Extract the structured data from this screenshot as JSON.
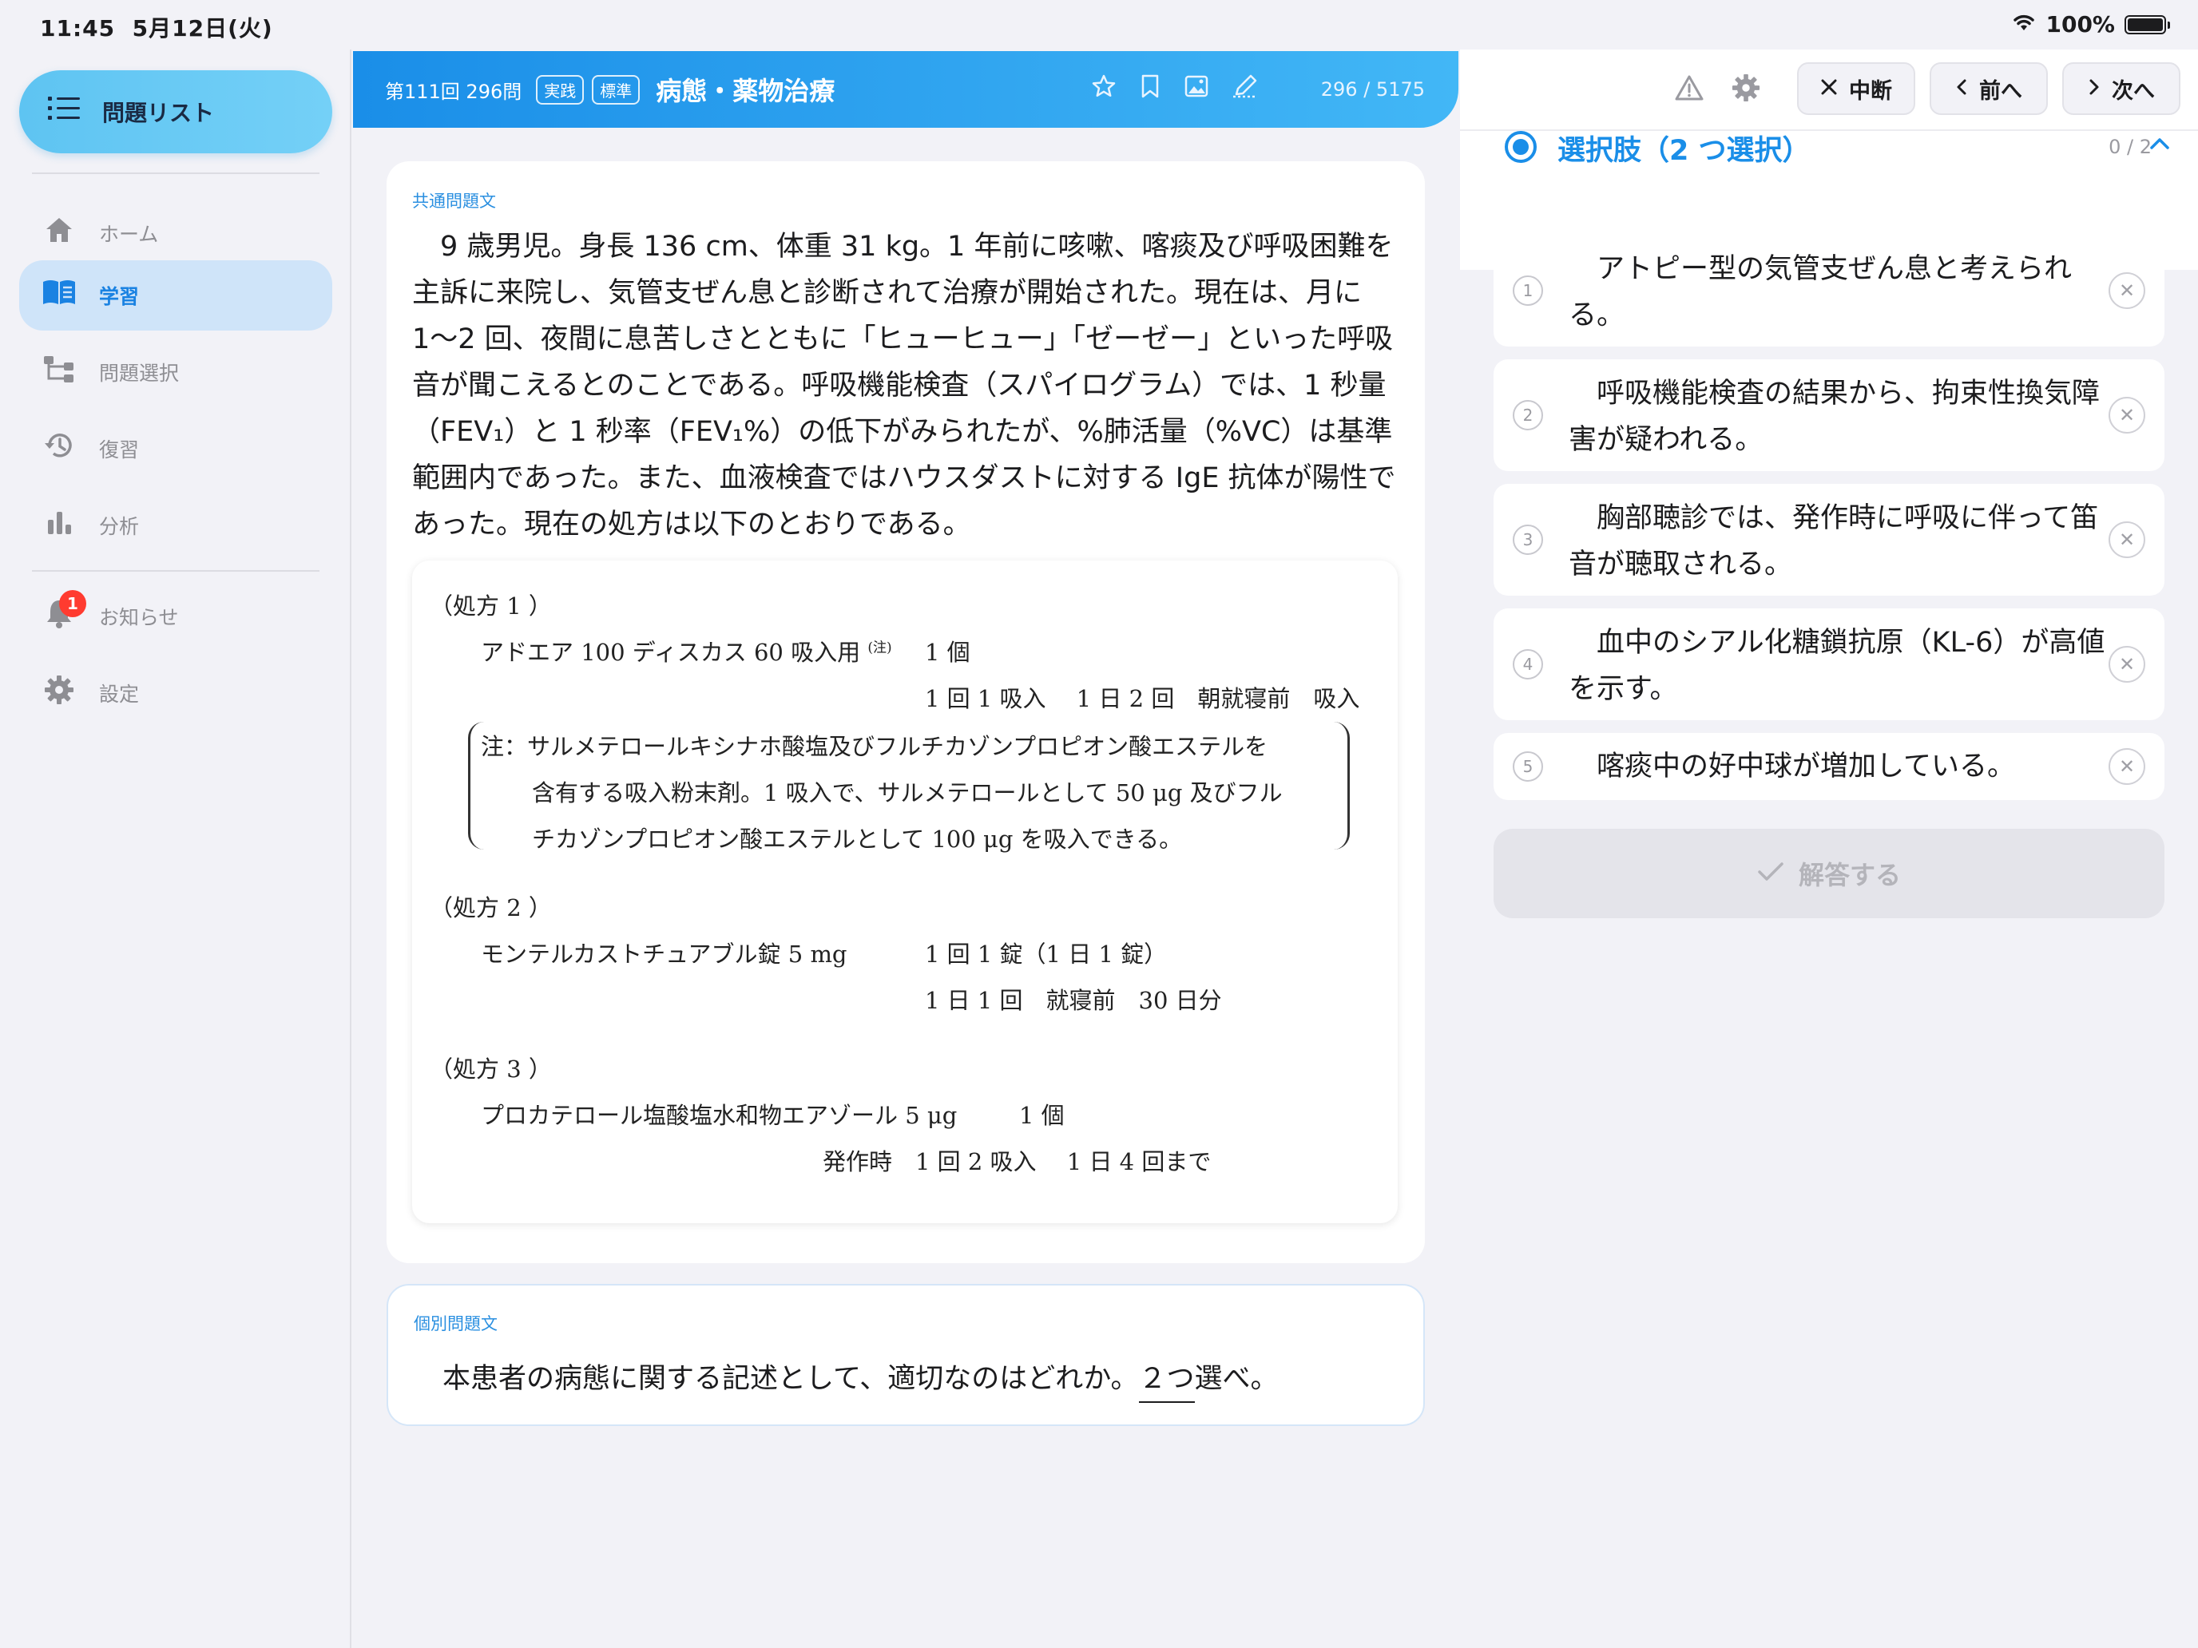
{
  "status_bar": {
    "time": "11:45",
    "date": "5月12日(火)",
    "battery": "100%"
  },
  "sidebar": {
    "list_button": "問題リスト",
    "items": [
      {
        "label": "ホーム",
        "icon": "home-icon"
      },
      {
        "label": "学習",
        "icon": "book-icon"
      },
      {
        "label": "問題選択",
        "icon": "tree-icon"
      },
      {
        "label": "復習",
        "icon": "history-icon"
      },
      {
        "label": "分析",
        "icon": "bar-chart-icon"
      },
      {
        "label": "お知らせ",
        "icon": "bell-icon",
        "badge": "1"
      },
      {
        "label": "設定",
        "icon": "gear-icon"
      }
    ]
  },
  "header": {
    "number": "第111回 296問",
    "tags": [
      "実践",
      "標準"
    ],
    "title": "病態・薬物治療",
    "count": "296 / 5175"
  },
  "question": {
    "common_label": "共通問題文",
    "common_text": "9 歳男児。身長 136 cm、体重 31 kg。1 年前に咳嗽、喀痰及び呼吸困難を主訴に来院し、気管支ぜん息と診断されて治療が開始された。現在は、月に 1〜2 回、夜間に息苦しさとともに「ヒューヒュー」「ゼーゼー」といった呼吸音が聞こえるとのことである。呼吸機能検査（スパイログラム）では、1 秒量（FEV₁）と 1 秒率（FEV₁%）の低下がみられたが、%肺活量（%VC）は基準範囲内であった。また、血液検査ではハウスダストに対する IgE 抗体が陽性であった。現在の処方は以下のとおりである。",
    "prescriptions": {
      "rx1_title": "（処方 1 ）",
      "rx1_drug": "アドエア 100 ディスカス 60 吸入用",
      "rx1_note_mark": "(注)",
      "rx1_qty": "1 個",
      "rx1_usage": "1 回 1 吸入　 1 日 2 回　朝就寝前　吸入",
      "rx1_note_1": "注：サルメテロールキシナホ酸塩及びフルチカゾンプロピオン酸エステルを",
      "rx1_note_2": "含有する吸入粉末剤。1 吸入で、サルメテロールとして 50 μg 及びフル",
      "rx1_note_3": "チカゾンプロピオン酸エステルとして 100 μg を吸入できる。",
      "rx2_title": "（処方 2 ）",
      "rx2_drug": "モンテルカストチュアブル錠 5 mg",
      "rx2_qty": "1 回 1 錠（1 日 1 錠）",
      "rx2_usage": "1 日 1 回　就寝前　30 日分",
      "rx3_title": "（処方 3 ）",
      "rx3_drug": "プロカテロール塩酸塩水和物エアゾール 5 μg",
      "rx3_qty": "1 個",
      "rx3_usage": "発作時　1 回 2 吸入　 1 日 4 回まで"
    },
    "specific_label": "個別問題文",
    "specific_text_pre": "本患者の病態に関する記述として、適切なのはどれか。",
    "specific_text_num": "２つ",
    "specific_text_post": "選べ。"
  },
  "right_panel": {
    "suspend": "中断",
    "prev": "前へ",
    "next": "次へ",
    "choice_title": "選択肢（2 つ選択）",
    "choice_count": "0 / 2",
    "choices": [
      {
        "num": "1",
        "text": "アトピー型の気管支ぜん息と考えられる。"
      },
      {
        "num": "2",
        "text": "呼吸機能検査の結果から、拘束性換気障害が疑われる。"
      },
      {
        "num": "3",
        "text": "胸部聴診では、発作時に呼吸に伴って笛音が聴取される。"
      },
      {
        "num": "4",
        "text": "血中のシアル化糖鎖抗原（KL-6）が高値を示す。"
      },
      {
        "num": "5",
        "text": "喀痰中の好中球が増加している。"
      }
    ],
    "answer_button": "解答する"
  },
  "colors": {
    "accent": "#1a8ee8",
    "badge": "#ff3b30",
    "active_bg": "#cfe4f9"
  }
}
